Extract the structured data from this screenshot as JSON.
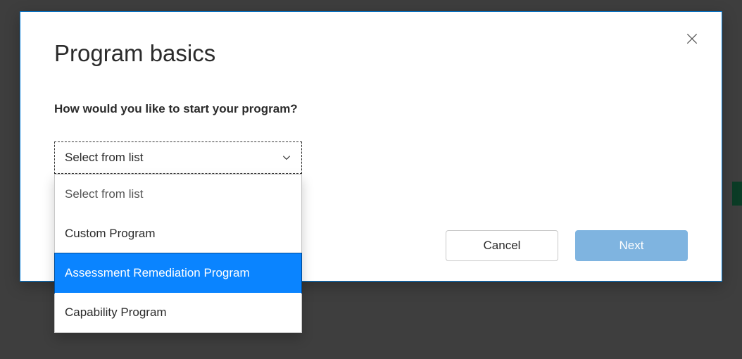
{
  "modal": {
    "title": "Program basics",
    "question": "How would you like to start your program?",
    "select": {
      "placeholder": "Select from list",
      "options": [
        "Select from list",
        "Custom Program",
        "Assessment Remediation Program",
        "Capability Program"
      ],
      "highlighted_index": 2
    },
    "buttons": {
      "cancel": "Cancel",
      "next": "Next"
    }
  }
}
